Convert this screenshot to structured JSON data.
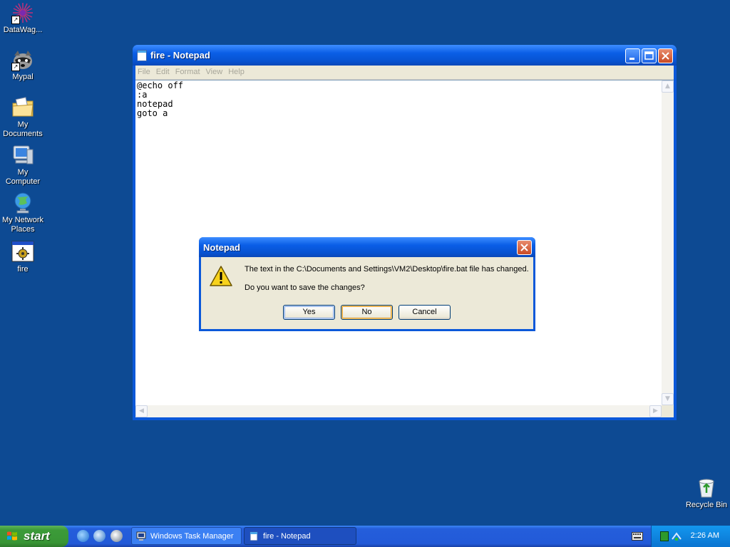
{
  "desktop": {
    "icons": [
      {
        "label": "DataWag..."
      },
      {
        "label": "Mypal"
      },
      {
        "label_line1": "My",
        "label_line2": "Documents"
      },
      {
        "label_line1": "My",
        "label_line2": "Computer"
      },
      {
        "label_line1": "My Network",
        "label_line2": "Places"
      },
      {
        "label": "fire"
      }
    ],
    "recycle_bin": "Recycle Bin"
  },
  "notepad": {
    "title": "fire - Notepad",
    "menu": [
      "File",
      "Edit",
      "Format",
      "View",
      "Help"
    ],
    "content": "@echo off\n:a\nnotepad\ngoto a",
    "buttons": {
      "minimize": "_",
      "maximize": "□",
      "close": "×"
    }
  },
  "dialog": {
    "title": "Notepad",
    "message_line1": "The text in the C:\\Documents and Settings\\VM2\\Desktop\\fire.bat file has changed.",
    "message_line2": "Do you want to save the changes?",
    "buttons": {
      "yes": "Yes",
      "no": "No",
      "cancel": "Cancel"
    },
    "close": "×"
  },
  "taskbar": {
    "start_label": "start",
    "tasks": [
      {
        "label": "Windows Task Manager",
        "active": false
      },
      {
        "label": "fire - Notepad",
        "active": true
      }
    ],
    "clock": "2:26 AM"
  },
  "colors": {
    "desktop": "#0d4a93",
    "title_blue": "#0a5ee6",
    "start_green": "#3c9b39"
  }
}
